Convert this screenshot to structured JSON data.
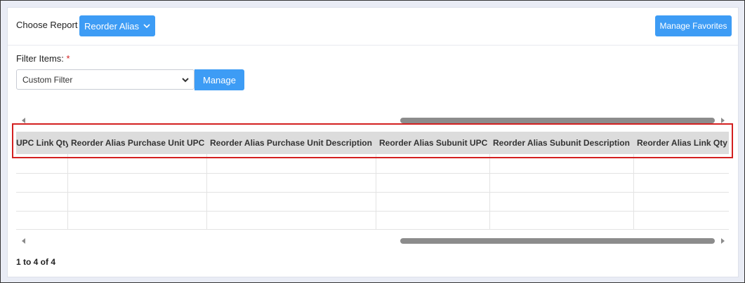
{
  "header": {
    "choose_report_label": "Choose Report",
    "report_button_label": "Reorder Alias",
    "manage_favorites_label": "Manage Favorites"
  },
  "filter": {
    "label": "Filter Items:",
    "required_marker": "*",
    "selected_value": "Custom Filter",
    "manage_label": "Manage"
  },
  "grid": {
    "columns": [
      "UPC Link Qty",
      "Reorder Alias Purchase Unit UPC",
      "Reorder Alias Purchase Unit Description",
      "Reorder Alias Subunit UPC",
      "Reorder Alias Subunit Description",
      "Reorder Alias Link Qty"
    ],
    "rows": [
      [
        "",
        "",
        "",
        "",
        "",
        ""
      ],
      [
        "",
        "",
        "",
        "",
        "",
        ""
      ],
      [
        "",
        "",
        "",
        "",
        "",
        ""
      ],
      [
        "",
        "",
        "",
        "",
        "",
        ""
      ]
    ]
  },
  "pagination": {
    "summary": "1 to 4 of 4"
  },
  "colors": {
    "accent": "#3d9cf5",
    "highlight": "#d32020",
    "header_bg": "#dcdcdc"
  }
}
